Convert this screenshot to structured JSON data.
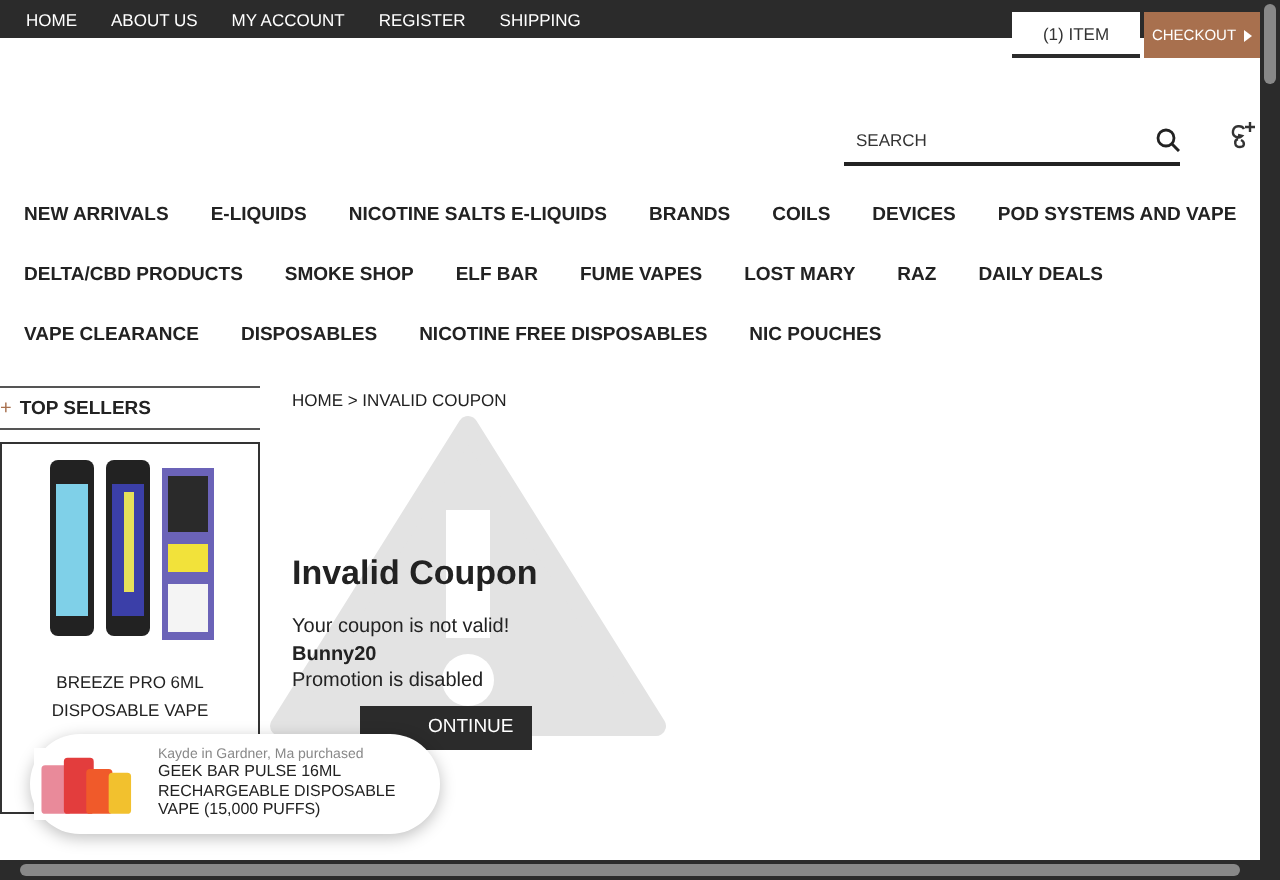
{
  "top_nav": {
    "links": [
      "HOME",
      "ABOUT US",
      "MY ACCOUNT",
      "REGISTER",
      "SHIPPING"
    ]
  },
  "cart": {
    "items": "(1) ITEM",
    "checkout": "CHECKOUT"
  },
  "search": {
    "placeholder": "SEARCH"
  },
  "main_nav": [
    [
      "NEW ARRIVALS",
      "E-LIQUIDS",
      "NICOTINE SALTS E-LIQUIDS",
      "BRANDS",
      "COILS",
      "DEVICES",
      "POD SYSTEMS AND VAPE"
    ],
    [
      "DELTA/CBD PRODUCTS",
      "SMOKE SHOP",
      "ELF BAR",
      "FUME VAPES",
      "LOST MARY",
      "RAZ",
      "DAILY DEALS"
    ],
    [
      "VAPE CLEARANCE",
      "DISPOSABLES",
      "NICOTINE FREE DISPOSABLES",
      "NIC POUCHES"
    ]
  ],
  "sidebar": {
    "heading_icon": "+",
    "heading": "TOP SELLERS",
    "product": {
      "name": "BREEZE PRO 6ML DISPOSABLE VAPE"
    }
  },
  "breadcrumb": "HOME > INVALID COUPON",
  "message": {
    "title": "Invalid Coupon",
    "text": "Your coupon is not valid!",
    "code": "Bunny20",
    "note": "Promotion is disabled",
    "button": "ONTINUE"
  },
  "purchase_popup": {
    "who": "Kayde in Gardner, Ma purchased",
    "product": "GEEK BAR PULSE 16ML RECHARGEABLE DISPOSABLE VAPE (15,000 PUFFS)"
  }
}
